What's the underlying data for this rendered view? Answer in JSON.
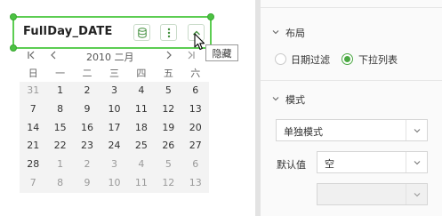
{
  "widget": {
    "title": "FullDay_DATE",
    "buttons": [
      {
        "icon": "database-icon"
      },
      {
        "icon": "more-vertical-icon"
      },
      {
        "icon": "chevron-up-icon"
      }
    ],
    "tooltip": "隐藏"
  },
  "calendar": {
    "month_label": "2010 二月",
    "weekdays": [
      "日",
      "一",
      "二",
      "三",
      "四",
      "五",
      "六"
    ],
    "weeks": [
      [
        {
          "d": "31",
          "m": true
        },
        {
          "d": "1"
        },
        {
          "d": "2"
        },
        {
          "d": "3"
        },
        {
          "d": "4"
        },
        {
          "d": "5"
        },
        {
          "d": "6"
        }
      ],
      [
        {
          "d": "7"
        },
        {
          "d": "8"
        },
        {
          "d": "9"
        },
        {
          "d": "10"
        },
        {
          "d": "11"
        },
        {
          "d": "12"
        },
        {
          "d": "13"
        }
      ],
      [
        {
          "d": "14"
        },
        {
          "d": "15"
        },
        {
          "d": "16"
        },
        {
          "d": "17"
        },
        {
          "d": "18"
        },
        {
          "d": "19"
        },
        {
          "d": "20"
        }
      ],
      [
        {
          "d": "21"
        },
        {
          "d": "22"
        },
        {
          "d": "23"
        },
        {
          "d": "24"
        },
        {
          "d": "25"
        },
        {
          "d": "26"
        },
        {
          "d": "27"
        }
      ],
      [
        {
          "d": "28"
        },
        {
          "d": "1",
          "m": true
        },
        {
          "d": "2",
          "m": true
        },
        {
          "d": "3",
          "m": true
        },
        {
          "d": "4",
          "m": true
        },
        {
          "d": "5",
          "m": true
        },
        {
          "d": "6",
          "m": true
        }
      ],
      [
        {
          "d": "7",
          "m": true
        },
        {
          "d": "8",
          "m": true
        },
        {
          "d": "9",
          "m": true
        },
        {
          "d": "10",
          "m": true
        },
        {
          "d": "11",
          "m": true
        },
        {
          "d": "12",
          "m": true
        },
        {
          "d": "13",
          "m": true
        }
      ]
    ]
  },
  "panel": {
    "layout": {
      "title": "布局",
      "options": [
        {
          "label": "日期过滤",
          "selected": false
        },
        {
          "label": "下拉列表",
          "selected": true
        }
      ]
    },
    "mode": {
      "title": "模式",
      "mode_select": "单独模式",
      "default_label": "默认值",
      "default_select": "空",
      "extra_select": ""
    }
  },
  "colors": {
    "accent": "#4cc243",
    "border_green": "#5ccd52"
  }
}
